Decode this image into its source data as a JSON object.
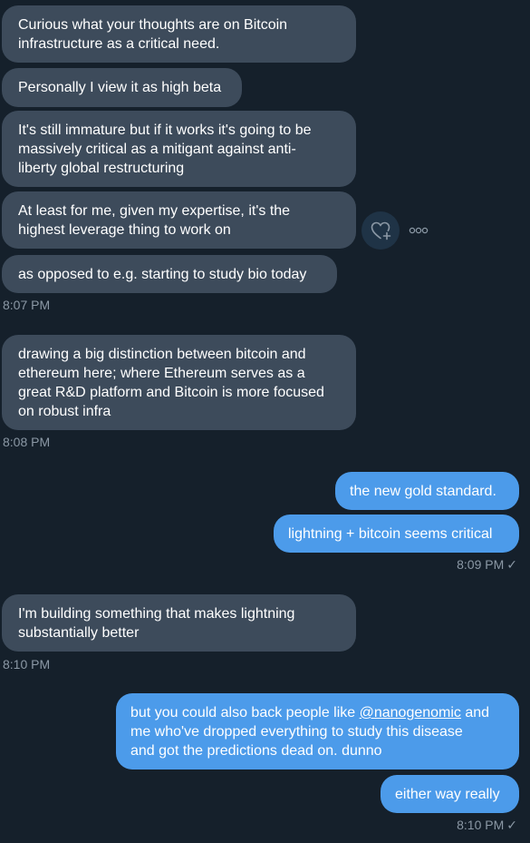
{
  "messages": {
    "m1": {
      "line1": "Curious what your thoughts are on Bitcoin",
      "line2": "infrastructure as a critical need."
    },
    "m2": {
      "line1": "Personally I view it as high beta"
    },
    "m3": {
      "line1": "It's still immature but if it works it's going to be",
      "line2": "massively critical as a mitigant against anti-",
      "line3": "liberty global restructuring"
    },
    "m4": {
      "line1": "At least for me, given my expertise, it's the",
      "line2": "highest leverage thing to work on"
    },
    "m5": {
      "line1": "as opposed to e.g. starting to study bio today"
    },
    "m6": {
      "line1": "drawing a big distinction between bitcoin and",
      "line2": "ethereum here; where Ethereum serves as a",
      "line3": "great R&D platform and Bitcoin is more focused",
      "line4": "on robust infra"
    },
    "m7": {
      "line1": "the new gold standard."
    },
    "m8": {
      "line1": "lightning + bitcoin seems critical"
    },
    "m9": {
      "line1": "I'm building something that makes lightning",
      "line2": "substantially better"
    },
    "m10": {
      "line1_pre": "but you could also back people like ",
      "mention": "@nanogenomic",
      "line1_post": " and",
      "line2": "me who've dropped everything to study this disease",
      "line3": "and got the predictions dead on. dunno"
    },
    "m11": {
      "line1": "either way really"
    }
  },
  "timestamps": {
    "t1": "8:07 PM",
    "t2": "8:08 PM",
    "t3": "8:09 PM",
    "t4": "8:10 PM",
    "t5": "8:10 PM"
  },
  "read_mark": "✓",
  "icons": {
    "react": "heart-plus-icon",
    "more": "more-options-icon"
  },
  "colors": {
    "background": "#15202b",
    "incoming_bubble": "#3d4b5b",
    "outgoing_bubble": "#4c9bea",
    "timestamp": "#8b98a5"
  }
}
